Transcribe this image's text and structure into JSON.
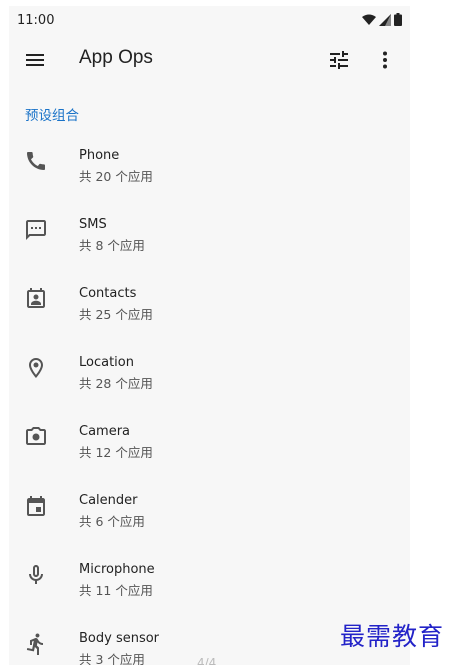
{
  "status_bar": {
    "time": "11:00",
    "icons": [
      "wifi-icon",
      "signal-icon",
      "battery-icon"
    ]
  },
  "app_bar": {
    "title": "App Ops",
    "icons": [
      "menu-icon",
      "tune-icon",
      "more-vert-icon"
    ]
  },
  "section": {
    "title": "预设组合"
  },
  "items": [
    {
      "name": "Phone",
      "count": "共 20 个应用",
      "icon": "phone-icon"
    },
    {
      "name": "SMS",
      "count": "共 8 个应用",
      "icon": "sms-icon"
    },
    {
      "name": "Contacts",
      "count": "共 25 个应用",
      "icon": "contacts-icon"
    },
    {
      "name": "Location",
      "count": "共 28 个应用",
      "icon": "location-icon"
    },
    {
      "name": "Camera",
      "count": "共 12 个应用",
      "icon": "camera-icon"
    },
    {
      "name": "Calender",
      "count": "共 6 个应用",
      "icon": "calendar-icon"
    },
    {
      "name": "Microphone",
      "count": "共 11 个应用",
      "icon": "microphone-icon"
    },
    {
      "name": "Body sensor",
      "count": "共 3 个应用",
      "icon": "body-sensor-icon"
    }
  ],
  "page_indicator": "4/4",
  "watermark": "最需教育",
  "colors": {
    "accent": "#1a73c8",
    "icon": "#555555",
    "background": "#f7f7f7",
    "watermark": "#2323c8"
  }
}
